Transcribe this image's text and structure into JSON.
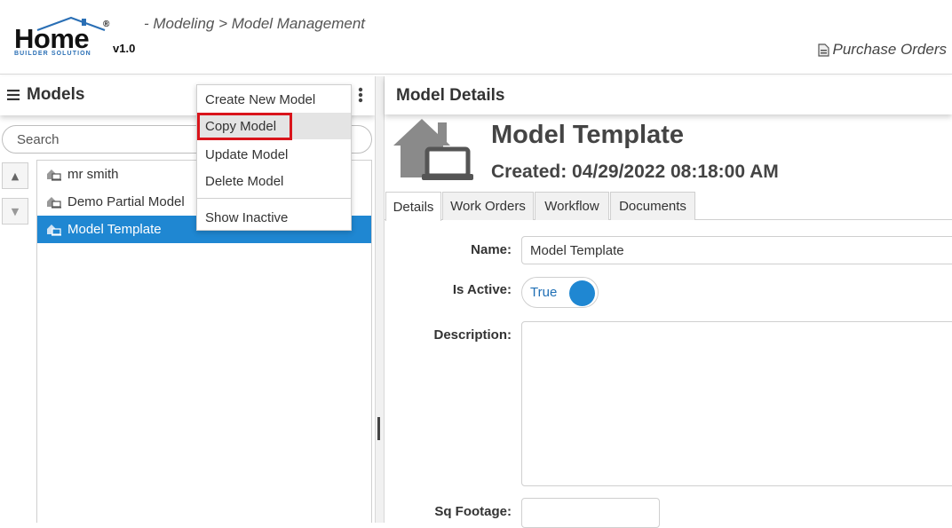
{
  "header": {
    "logo_word": "Home",
    "logo_sub": "BUILDER SOLUTION",
    "logo_reg": "®",
    "version": "v1.0",
    "breadcrumb": "- Modeling > Model Management",
    "purchase_orders": "Purchase Orders"
  },
  "models_panel": {
    "title": "Models",
    "search_placeholder": "Search",
    "up_arrow": "▲",
    "down_arrow": "▼",
    "items": [
      {
        "label": "mr smith",
        "selected": false
      },
      {
        "label": "Demo Partial Model",
        "selected": false
      },
      {
        "label": "Model Template",
        "selected": true
      }
    ]
  },
  "context_menu": {
    "create": "Create New Model",
    "copy": "Copy Model",
    "update": "Update Model",
    "delete": "Delete Model",
    "show_inactive": "Show Inactive"
  },
  "details": {
    "title": "Model Details",
    "model_name": "Model Template",
    "created": "Created: 04/29/2022 08:18:00 AM",
    "tabs": [
      {
        "label": "Details",
        "active": true
      },
      {
        "label": "Work Orders",
        "active": false
      },
      {
        "label": "Workflow",
        "active": false
      },
      {
        "label": "Documents",
        "active": false
      }
    ],
    "fields": {
      "name_label": "Name:",
      "name_value": "Model Template",
      "active_label": "Is Active:",
      "active_value": "True",
      "description_label": "Description:",
      "description_value": "",
      "sqft_label": "Sq Footage:",
      "sqft_value": ""
    }
  },
  "colors": {
    "accent": "#1f87d2",
    "highlight_outline": "#d9141b"
  }
}
